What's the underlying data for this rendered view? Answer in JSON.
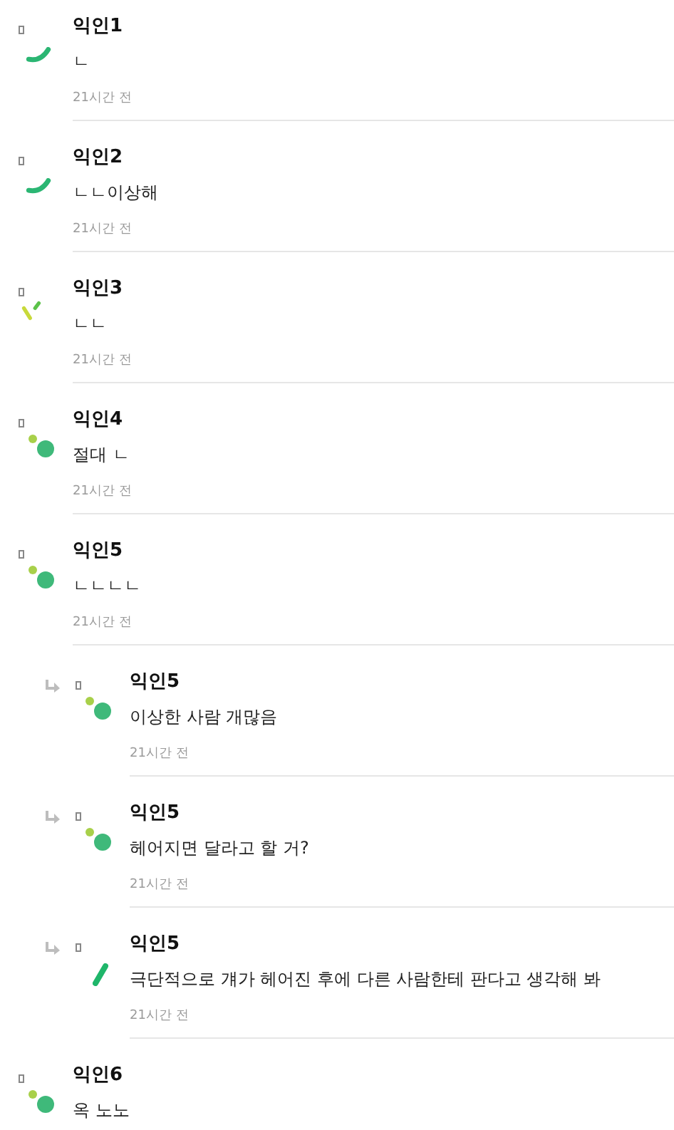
{
  "comments": [
    {
      "author": "익인1",
      "text": "ㄴ",
      "time": "21시간 전",
      "reply": false,
      "kind": "arc"
    },
    {
      "author": "익인2",
      "text": "ㄴㄴ이상해",
      "time": "21시간 전",
      "reply": false,
      "kind": "arc"
    },
    {
      "author": "익인3",
      "text": "ㄴㄴ",
      "time": "21시간 전",
      "reply": false,
      "kind": "slash"
    },
    {
      "author": "익인4",
      "text": "절대 ㄴ",
      "time": "21시간 전",
      "reply": false,
      "kind": "dots"
    },
    {
      "author": "익인5",
      "text": "ㄴㄴㄴㄴ",
      "time": "21시간 전",
      "reply": false,
      "kind": "dots"
    },
    {
      "author": "익인5",
      "text": "이상한 사람 개많음",
      "time": "21시간 전",
      "reply": true,
      "kind": "dots"
    },
    {
      "author": "익인5",
      "text": "헤어지면 달라고 할 거?",
      "time": "21시간 전",
      "reply": true,
      "kind": "dots"
    },
    {
      "author": "익인5",
      "text": "극단적으로 걔가 헤어진 후에 다른 사람한테 판다고 생각해 봐",
      "time": "21시간 전",
      "reply": true,
      "kind": "bar"
    },
    {
      "author": "익인6",
      "text": "옥 노노",
      "reply": false,
      "kind": "dots"
    }
  ]
}
